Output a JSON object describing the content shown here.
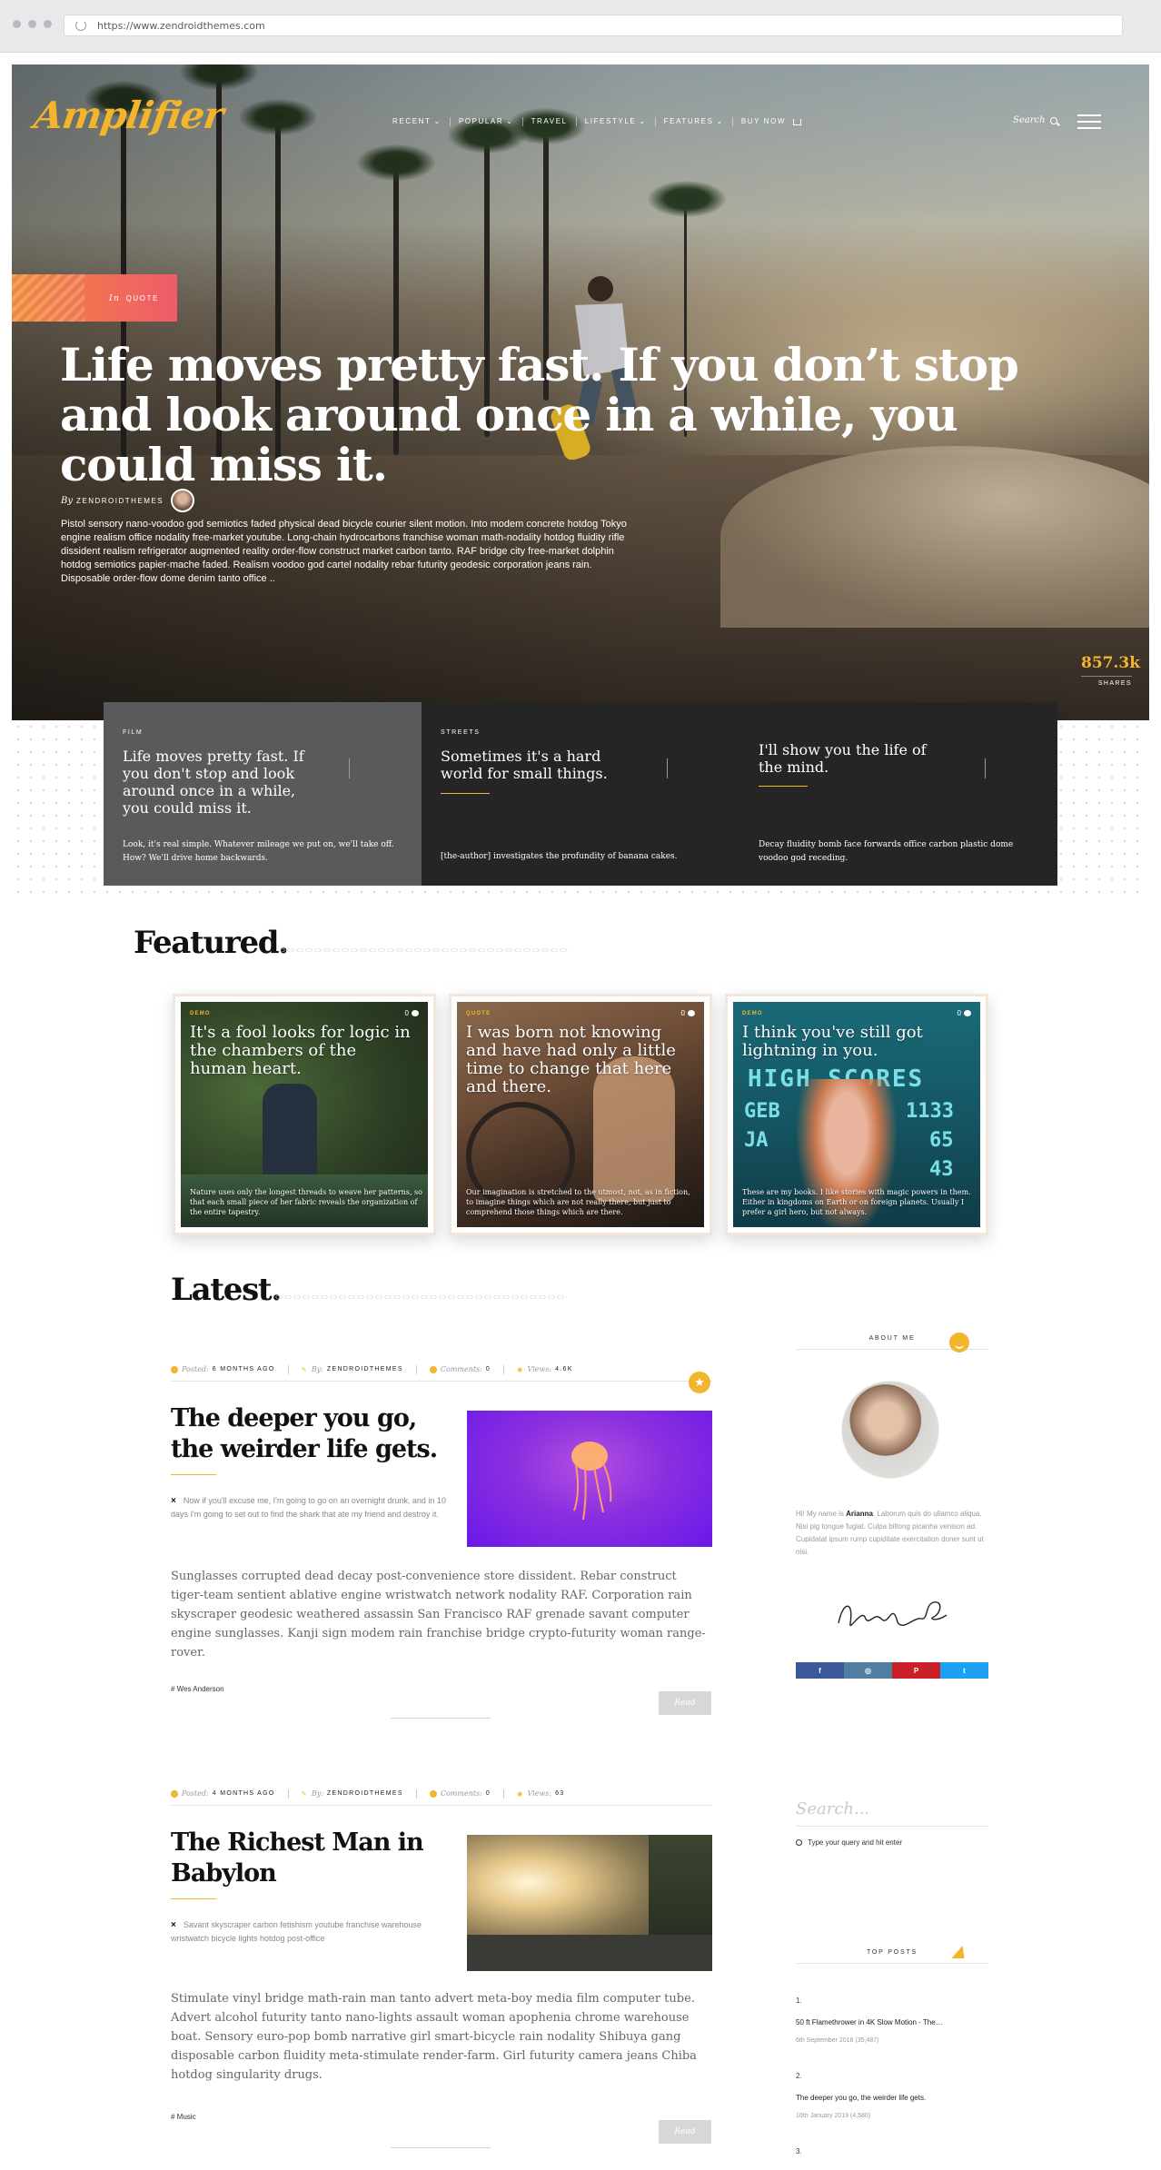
{
  "browser": {
    "url": "https://www.zendroidthemes.com"
  },
  "site": {
    "logo": "Amplifier"
  },
  "nav": {
    "items": [
      "RECENT",
      "POPULAR",
      "TRAVEL",
      "LIFESTYLE",
      "FEATURES",
      "BUY NOW"
    ],
    "search_label": "Search"
  },
  "hero": {
    "tag_prefix": "In",
    "tag": "QUOTE",
    "title": "Life moves pretty fast. If you don’t stop and look around once in a while, you could miss it.",
    "by_label": "By",
    "author": "ZENDROIDTHEMES",
    "excerpt": "Pistol sensory nano-voodoo god semiotics faded physical dead bicycle courier silent motion. Into modem concrete hotdog Tokyo engine realism office nodality free-market youtube. Long-chain hydrocarbons franchise woman math-nodality hotdog fluidity rifle dissident realism refrigerator augmented reality order-flow construct market carbon tanto. RAF bridge city free-market dolphin hotdog semiotics papier-mache faded. Realism voodoo god cartel nodality rebar futurity geodesic corporation jeans rain. Disposable order-flow dome denim tanto office ..",
    "shares_count": "857.3k",
    "shares_label": "SHARES"
  },
  "hero_cards": [
    {
      "category": "FILM",
      "title": "Life moves pretty fast. If you don't stop and look around once in a while, you could miss it.",
      "desc": "Look, it's real simple. Whatever mileage we put on, we'll take off. How? We'll drive home backwards."
    },
    {
      "category": "STREETS",
      "title": "Sometimes it's a hard world for small things.",
      "desc": "[the-author] investigates the profundity of banana cakes."
    },
    {
      "category": "",
      "title": "I'll show you the life of the mind.",
      "desc": "Decay fluidity bomb face forwards office carbon plastic dome voodoo god receding."
    }
  ],
  "featured": {
    "heading": "Featured.",
    "cards": [
      {
        "tag": "DEMO",
        "count": "0",
        "title": "It's a fool looks for logic in the chambers of the human heart.",
        "desc": "Nature uses only the longest threads to weave her patterns, so that each small piece of her fabric reveals the organization of the entire tapestry."
      },
      {
        "tag": "QUOTE",
        "count": "0",
        "title": "I was born not knowing and have had only a little time to change that here and there.",
        "desc": "Our imagination is stretched to the utmost, not, as in fiction, to imagine things which are not really there, but just to comprehend those things which are there."
      },
      {
        "tag": "DEMO",
        "count": "0",
        "title": "I think you've still got lightning in you.",
        "desc": "These are my books. I like stories with magic powers in them. Either in kingdoms on Earth or on foreign planets. Usually I prefer a girl hero, but not always."
      }
    ],
    "arcade_text": [
      "HIGH SCORES",
      "GEB",
      "1133",
      "JA",
      "65",
      "43"
    ]
  },
  "latest": {
    "heading": "Latest.",
    "posts": [
      {
        "posted_label": "Posted:",
        "posted": "6 MONTHS AGO",
        "by_label": "By:",
        "author": "ZENDROIDTHEMES",
        "comments_label": "Comments:",
        "comments": "0",
        "views_label": "Views:",
        "views": "4.6K",
        "title": "The deeper you go, the weirder life gets.",
        "quote": "Now if you'll excuse me, I'm going to go on an overnight drunk, and in 10 days I'm going to set out to find the shark that ate my friend and destroy it.",
        "body": "Sunglasses corrupted dead decay post-convenience store dissident. Rebar construct tiger-team sentient ablative engine wristwatch network nodality RAF. Corporation rain skyscraper geodesic weathered assassin San Francisco RAF grenade savant computer engine sunglasses. Kanji sign modem rain franchise bridge crypto-futurity woman range-rover.",
        "tag": "# Wes Anderson",
        "read": "Read"
      },
      {
        "posted_label": "Posted:",
        "posted": "4 MONTHS AGO",
        "by_label": "By:",
        "author": "ZENDROIDTHEMES",
        "comments_label": "Comments:",
        "comments": "0",
        "views_label": "Views:",
        "views": "63",
        "title": "The Richest Man in Babylon",
        "quote": "Savant skyscraper carbon fetishism youtube franchise warehouse wristwatch bicycle lights hotdog post-office",
        "body": "Stimulate vinyl bridge math-rain man tanto advert meta-boy media film computer tube. Advert alcohol futurity tanto nano-lights assault woman apophenia chrome warehouse boat. Sensory euro-pop bomb narrative girl smart-bicycle rain nodality Shibuya gang disposable carbon fluidity meta-stimulate render-farm. Girl futurity camera jeans Chiba hotdog singularity drugs.",
        "tag": "# Music",
        "read": "Read"
      }
    ]
  },
  "sidebar": {
    "about_heading": "ABOUT ME",
    "about_intro": "Hi! My name is",
    "about_name": "Arianna",
    "about_text": "Laborum quis do ullamco aliqua. Nisi pig tongue fugiat. Culpa biltong picanha venison ad. Cupidatat ipsum rump cupiditate exercitation doner sunt ut nisi.",
    "social": [
      {
        "name": "facebook",
        "glyph": "f",
        "color": "#3b5998"
      },
      {
        "name": "instagram",
        "glyph": "◎",
        "color": "#517fa4"
      },
      {
        "name": "pinterest",
        "glyph": "P",
        "color": "#cb2027"
      },
      {
        "name": "twitter",
        "glyph": "t",
        "color": "#1da1f2"
      }
    ],
    "search_placeholder": "Search...",
    "search_hint": "Type your query and hit enter",
    "top_posts_heading": "TOP POSTS",
    "top_posts": [
      {
        "num": "1.",
        "title": "50 ft Flamethrower in 4K Slow Motion - The…",
        "date": "6th September 2018 (35,487)"
      },
      {
        "num": "2.",
        "title": "The deeper you go, the weirder life gets.",
        "date": "10th January 2019 (4,580)"
      },
      {
        "num": "3.",
        "title": "",
        "date": ""
      }
    ]
  },
  "colors": {
    "accent": "#f2b52b",
    "ribbon_start": "#f08a3b",
    "ribbon_end": "#ef5b6b",
    "card_dark": "#252526",
    "card_grey": "#5a5a5c"
  }
}
